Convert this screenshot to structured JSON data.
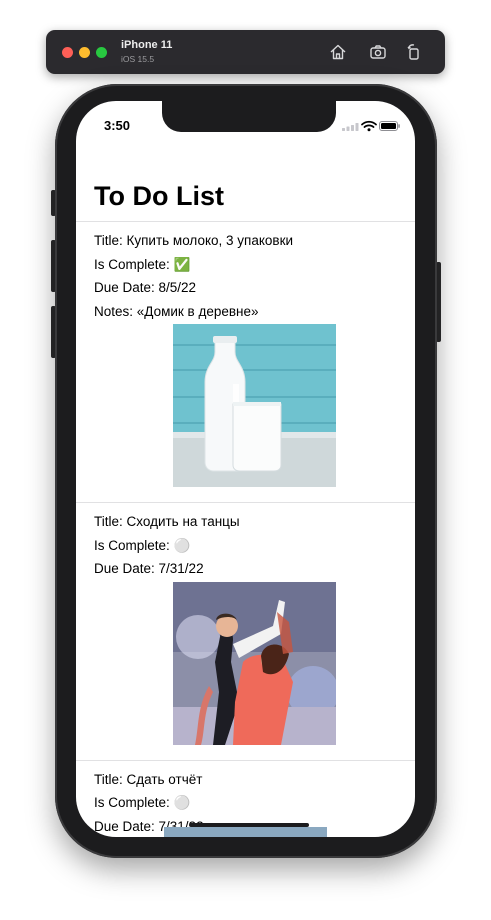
{
  "simulator": {
    "device_name": "iPhone 11",
    "os_version": "iOS 15.5"
  },
  "status_bar": {
    "time": "3:50"
  },
  "nav": {
    "title": "To Do List"
  },
  "items": [
    {
      "title_label": "Title: Купить молоко, 3 упаковки",
      "complete_label": "Is Complete: ✅",
      "due_label": "Due Date: 8/5/22",
      "notes_label": "Notes: «Домик в деревне»",
      "image": "milk-photo"
    },
    {
      "title_label": "Title: Сходить на танцы",
      "complete_label": "Is Complete: ⚪️",
      "due_label": "Due Date: 7/31/22",
      "image": "dance-photo"
    },
    {
      "title_label": "Title: Сдать отчёт",
      "complete_label": "Is Complete: ⚪️",
      "due_label": "Due Date: 7/31/22"
    }
  ],
  "colors": {
    "sim_bar": "#2b2a2e",
    "device": "#1c1c1e",
    "divider": "#e1e1e3"
  }
}
